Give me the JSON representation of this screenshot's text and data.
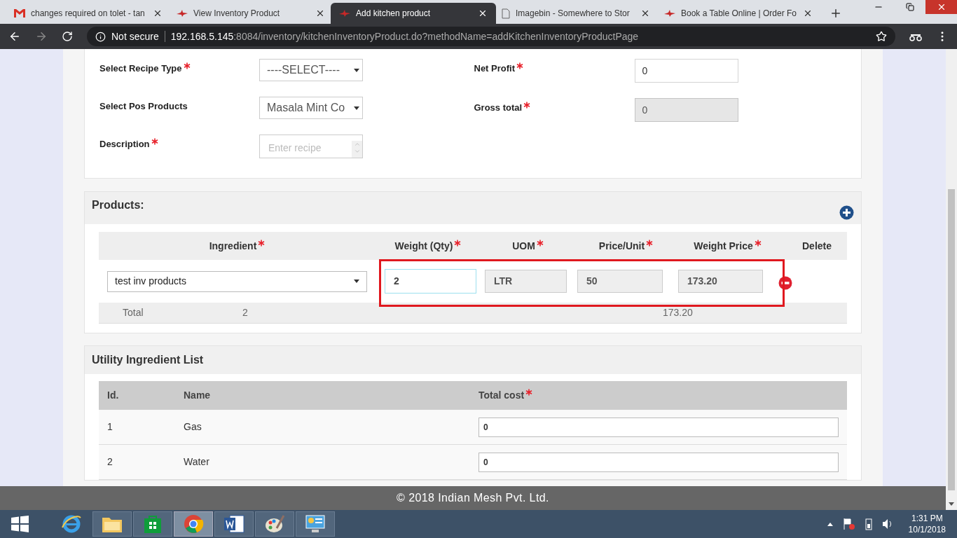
{
  "browser": {
    "tabs": [
      {
        "title": "changes required on tolet - tan",
        "kind": "mail",
        "selected": false
      },
      {
        "title": "View Inventory Product",
        "kind": "site",
        "selected": false
      },
      {
        "title": "Add kitchen product",
        "kind": "site",
        "selected": true
      },
      {
        "title": "Imagebin - Somewhere to Stor",
        "kind": "doc",
        "selected": false
      },
      {
        "title": "Book a Table Online | Order Fo",
        "kind": "site",
        "selected": false
      }
    ],
    "security": "Not secure",
    "host": "192.168.5.145",
    "path": ":8084/inventory/kitchenInventoryProduct.do?methodName=addKitchenInventoryProductPage"
  },
  "form": {
    "left": [
      {
        "label": "Select Recipe Type",
        "required": true,
        "kind": "select",
        "value": "----SELECT----"
      },
      {
        "label": "Select Pos Products",
        "required": false,
        "kind": "select",
        "value": "Masala Mint Co"
      },
      {
        "label": "Description",
        "required": true,
        "kind": "textarea",
        "placeholder": "Enter recipe"
      }
    ],
    "right": [
      {
        "label": "Net Profit",
        "required": true,
        "kind": "input",
        "value": "0",
        "disabled": false
      },
      {
        "label": "Gross total",
        "required": true,
        "kind": "input",
        "value": "0",
        "disabled": true
      }
    ]
  },
  "products": {
    "title": "Products:",
    "columns": [
      {
        "label": "Ingredient",
        "required": true
      },
      {
        "label": "Weight (Qty)",
        "required": true
      },
      {
        "label": "UOM",
        "required": true
      },
      {
        "label": "Price/Unit",
        "required": true
      },
      {
        "label": "Weight Price",
        "required": true
      },
      {
        "label": "Delete",
        "required": false
      }
    ],
    "rows": [
      {
        "ingredient": "test inv products",
        "weight": "2",
        "uom": "LTR",
        "price_unit": "50",
        "weight_price": "173.20"
      }
    ],
    "total": {
      "label": "Total",
      "weight": "2",
      "weight_price": "173.20"
    }
  },
  "utility": {
    "title": "Utility Ingredient List",
    "columns": [
      {
        "label": "Id.",
        "required": false
      },
      {
        "label": "Name",
        "required": false
      },
      {
        "label": "Total cost",
        "required": true
      }
    ],
    "rows": [
      {
        "id": "1",
        "name": "Gas",
        "total_cost": "0"
      },
      {
        "id": "2",
        "name": "Water",
        "total_cost": "0"
      }
    ]
  },
  "footer": "© 2018 Indian Mesh Pvt. Ltd.",
  "taskbar": {
    "time": "1:31 PM",
    "date": "10/1/2018",
    "apps": [
      {
        "kind": "ie",
        "selected": false
      },
      {
        "kind": "folder",
        "selected": false
      },
      {
        "kind": "store",
        "selected": false
      },
      {
        "kind": "chrome",
        "selected": true
      },
      {
        "kind": "word",
        "selected": false
      },
      {
        "kind": "paint",
        "selected": false
      },
      {
        "kind": "panel",
        "selected": false
      }
    ]
  }
}
